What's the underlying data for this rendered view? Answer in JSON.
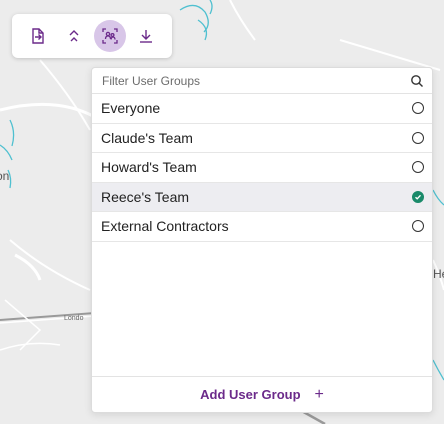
{
  "map": {
    "labels": [
      "on",
      "He",
      "Londo"
    ]
  },
  "toolbar": {
    "buttons": [
      {
        "icon": "export-file-icon",
        "active": false
      },
      {
        "icon": "collapse-up-icon",
        "active": false
      },
      {
        "icon": "user-groups-icon",
        "active": true
      },
      {
        "icon": "download-icon",
        "active": false
      }
    ]
  },
  "panel": {
    "filter_placeholder": "Filter User Groups",
    "groups": [
      {
        "label": "Everyone",
        "selected": false
      },
      {
        "label": "Claude's Team",
        "selected": false
      },
      {
        "label": "Howard's Team",
        "selected": false
      },
      {
        "label": "Reece's Team",
        "selected": true
      },
      {
        "label": "External Contractors",
        "selected": false
      }
    ],
    "add_label": "Add User Group",
    "add_icon": "+"
  },
  "colors": {
    "accent": "#6b2a8a",
    "active_tool_bg": "#d8c6e8",
    "checked": "#1a8a6a",
    "map_water": "#4fc0d0"
  }
}
